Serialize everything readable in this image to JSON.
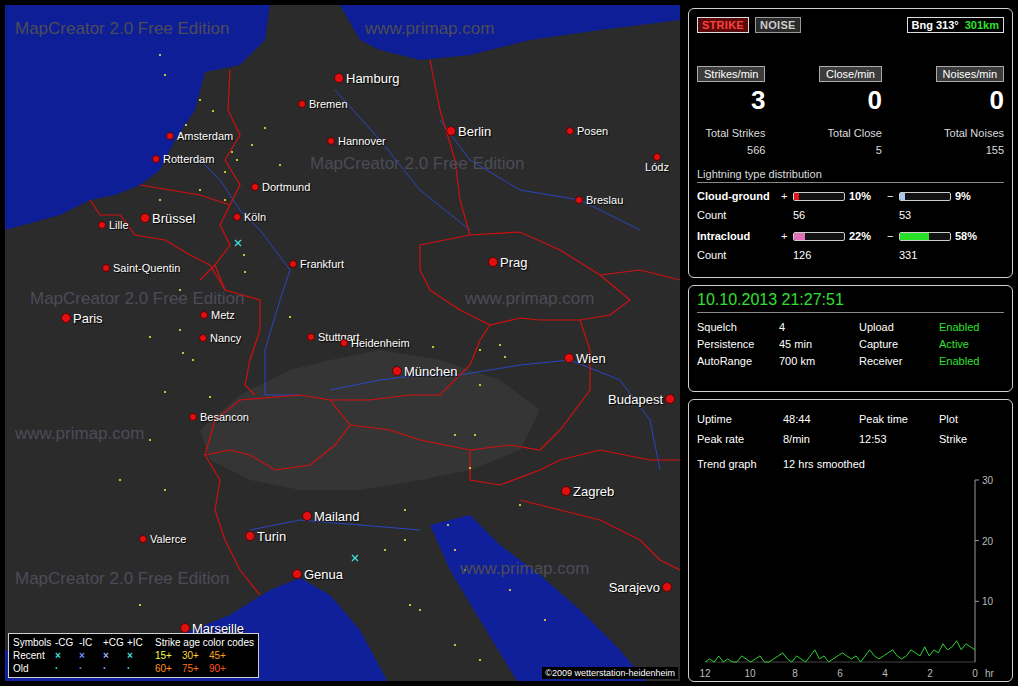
{
  "map": {
    "watermarks": [
      "MapCreator 2.0 Free Edition",
      "www.primap.com",
      "MapCreator 2.0 Free Edition",
      "MapCreator 2.0 Free Edition",
      "www.primap.com",
      "www.primap.com",
      "www.primap.com",
      "MapCreator 2.0 Free Edition"
    ],
    "cities": [
      {
        "name": "Hamburg",
        "kind": "major"
      },
      {
        "name": "Bremen",
        "kind": "minor"
      },
      {
        "name": "Amsterdam",
        "kind": "minor"
      },
      {
        "name": "Hannover",
        "kind": "minor"
      },
      {
        "name": "Berlin",
        "kind": "major"
      },
      {
        "name": "Posen",
        "kind": "minor"
      },
      {
        "name": "Lódz",
        "kind": "minor"
      },
      {
        "name": "Rotterdam",
        "kind": "minor"
      },
      {
        "name": "Dortmund",
        "kind": "minor"
      },
      {
        "name": "Breslau",
        "kind": "minor"
      },
      {
        "name": "Brüssel",
        "kind": "major"
      },
      {
        "name": "Köln",
        "kind": "minor"
      },
      {
        "name": "Lille",
        "kind": "minor"
      },
      {
        "name": "Frankfurt",
        "kind": "minor"
      },
      {
        "name": "Prag",
        "kind": "major"
      },
      {
        "name": "Saint-Quentin",
        "kind": "minor"
      },
      {
        "name": "Paris",
        "kind": "major"
      },
      {
        "name": "Metz",
        "kind": "minor"
      },
      {
        "name": "Nancy",
        "kind": "minor"
      },
      {
        "name": "Stuttgart",
        "kind": "minor"
      },
      {
        "name": "Heidenheim",
        "kind": "minor"
      },
      {
        "name": "München",
        "kind": "major"
      },
      {
        "name": "Wien",
        "kind": "major"
      },
      {
        "name": "Budapest",
        "kind": "major"
      },
      {
        "name": "Besancon",
        "kind": "minor"
      },
      {
        "name": "Zagreb",
        "kind": "major"
      },
      {
        "name": "Mailand",
        "kind": "major"
      },
      {
        "name": "Turin",
        "kind": "major"
      },
      {
        "name": "Valerce",
        "kind": "minor"
      },
      {
        "name": "Genua",
        "kind": "major"
      },
      {
        "name": "Sarajevo",
        "kind": "major"
      },
      {
        "name": "Marseille",
        "kind": "major"
      }
    ],
    "strikes": [
      {
        "kind": "recent"
      },
      {
        "kind": "recent"
      },
      {
        "kind": "old"
      },
      {
        "kind": "old"
      },
      {
        "kind": "old"
      },
      {
        "kind": "old"
      },
      {
        "kind": "old"
      },
      {
        "kind": "old"
      },
      {
        "kind": "old"
      },
      {
        "kind": "old"
      },
      {
        "kind": "old"
      },
      {
        "kind": "old"
      },
      {
        "kind": "old"
      },
      {
        "kind": "old"
      },
      {
        "kind": "old"
      },
      {
        "kind": "old"
      },
      {
        "kind": "old"
      },
      {
        "kind": "old"
      },
      {
        "kind": "old"
      },
      {
        "kind": "old"
      },
      {
        "kind": "old"
      },
      {
        "kind": "old"
      },
      {
        "kind": "old"
      },
      {
        "kind": "old"
      },
      {
        "kind": "old"
      },
      {
        "kind": "old"
      },
      {
        "kind": "old"
      },
      {
        "kind": "old"
      },
      {
        "kind": "old"
      },
      {
        "kind": "old"
      },
      {
        "kind": "old"
      },
      {
        "kind": "old"
      },
      {
        "kind": "old"
      },
      {
        "kind": "old"
      },
      {
        "kind": "old"
      },
      {
        "kind": "old"
      },
      {
        "kind": "old"
      },
      {
        "kind": "old"
      },
      {
        "kind": "old"
      },
      {
        "kind": "old"
      },
      {
        "kind": "old"
      },
      {
        "kind": "old"
      },
      {
        "kind": "old"
      },
      {
        "kind": "old"
      },
      {
        "kind": "old"
      },
      {
        "kind": "old"
      },
      {
        "kind": "old"
      },
      {
        "kind": "old"
      },
      {
        "kind": "old"
      },
      {
        "kind": "old"
      },
      {
        "kind": "old"
      }
    ],
    "legend": {
      "title": "Symbols",
      "types": [
        "-CG",
        "-IC",
        "+CG",
        "+IC"
      ],
      "age_title": "Strike age color codes",
      "rows": [
        {
          "label": "Recent",
          "symbol": "×",
          "symbol_colors": [
            "#40e0e0",
            "#7090ff",
            "#a0b0ff",
            "#40e0e0"
          ],
          "ages": [
            {
              "text": "15+",
              "color": "#ffff40"
            },
            {
              "text": "30+",
              "color": "#ffd030"
            },
            {
              "text": "45+",
              "color": "#ffa020"
            }
          ]
        },
        {
          "label": "Old",
          "symbol": "·",
          "symbol_colors": [
            "#40e0e0",
            "#7090ff",
            "#a0b0ff",
            "#40e0e0"
          ],
          "ages": [
            {
              "text": "60+",
              "color": "#ff9020"
            },
            {
              "text": "75+",
              "color": "#ff7020"
            },
            {
              "text": "90+",
              "color": "#ff5020"
            }
          ]
        }
      ]
    },
    "copyright": "©2009 wetterstation-heidenheim"
  },
  "mode_buttons": [
    {
      "label": "STRIKE",
      "selected": true
    },
    {
      "label": "NOISE",
      "selected": false
    }
  ],
  "bearing": {
    "label": "Bng 313°",
    "distance": "301km"
  },
  "rates": [
    {
      "label": "Strikes/min",
      "value": "3",
      "total_label": "Total Strikes",
      "total": "566"
    },
    {
      "label": "Close/min",
      "value": "0",
      "total_label": "Total Close",
      "total": "5"
    },
    {
      "label": "Noises/min",
      "value": "0",
      "total_label": "Total Noises",
      "total": "155"
    }
  ],
  "distribution": {
    "title": "Lightning type distribution",
    "count_label": "Count",
    "rows": [
      {
        "name": "Cloud-ground",
        "pos": {
          "sign": "+",
          "level": 0.1,
          "percent": "10%",
          "count": "56",
          "color": "#e01818"
        },
        "neg": {
          "sign": "−",
          "level": 0.09,
          "percent": "9%",
          "count": "53",
          "color": "#a8c8f0"
        }
      },
      {
        "name": "Intracloud",
        "pos": {
          "sign": "+",
          "level": 0.22,
          "percent": "22%",
          "count": "126",
          "color": "#e070b8"
        },
        "neg": {
          "sign": "−",
          "level": 0.58,
          "percent": "58%",
          "count": "331",
          "color": "#28e028"
        }
      }
    ]
  },
  "status": {
    "datetime": "10.10.2013 21:27:51",
    "settings": [
      {
        "label": "Squelch",
        "value": "4",
        "color": "#ffffff"
      },
      {
        "label": "Upload",
        "value": "Enabled",
        "color": "#30e030"
      },
      {
        "label": "Persistence",
        "value": "45 min",
        "color": "#ffffff"
      },
      {
        "label": "Capture",
        "value": "Active",
        "color": "#30e030"
      },
      {
        "label": "AutoRange",
        "value": "700 km",
        "color": "#ffffff"
      },
      {
        "label": "Receiver",
        "value": "Enabled",
        "color": "#30e030"
      }
    ]
  },
  "trend": {
    "stats": [
      {
        "label": "Uptime",
        "value": "48:44"
      },
      {
        "label": "Peak rate",
        "value": "8/min"
      }
    ],
    "stacked": [
      {
        "label": "Peak time",
        "value": "12:53"
      },
      {
        "label": "Plot",
        "value": "Strike"
      }
    ],
    "graph_label": "Trend graph",
    "graph_value": "12 hrs smoothed",
    "y_ticks": [
      "30",
      "20",
      "10"
    ],
    "x_ticks": [
      "12",
      "10",
      "8",
      "6",
      "4",
      "2",
      "0"
    ],
    "x_unit": "hr",
    "series": [
      {
        "color": "#30d030",
        "values": [
          0,
          0.5,
          0,
          1,
          0,
          0.5,
          0,
          0,
          1,
          0.5,
          0,
          0.5,
          1,
          0,
          0,
          0.5,
          1,
          1.5,
          0.5,
          0,
          1,
          0.5,
          0,
          1,
          2,
          0.5,
          1,
          0,
          0.5,
          1,
          1.5,
          1,
          0.5,
          1,
          0,
          1,
          2,
          1,
          0.5,
          1,
          1.5,
          2,
          1,
          0.5,
          1,
          2,
          1.5,
          1,
          2.5,
          1,
          2,
          1.5,
          3,
          2,
          2.5,
          3.5,
          2,
          3,
          2.5,
          2
        ]
      }
    ]
  }
}
